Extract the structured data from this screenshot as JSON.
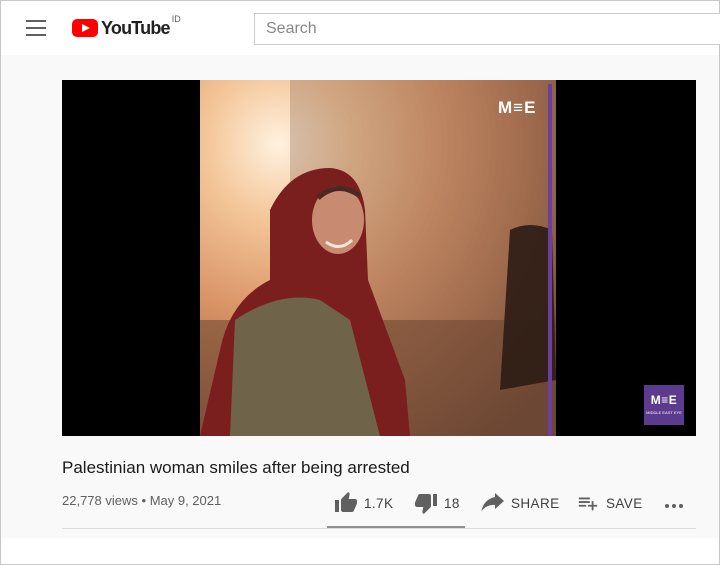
{
  "header": {
    "brand": "YouTube",
    "country_code": "ID",
    "search_placeholder": "Search"
  },
  "video": {
    "overlay_logo": "M≡E",
    "badge_text": "M≡E",
    "badge_subtext": "MIDDLE EAST EYE",
    "title": "Palestinian woman smiles after being arrested",
    "views": "22,778 views",
    "date": "May 9, 2021",
    "like_ratio": 0.99
  },
  "actions": {
    "likes": "1.7K",
    "dislikes": "18",
    "share_label": "SHARE",
    "save_label": "SAVE"
  },
  "colors": {
    "brand_red": "#ff0000",
    "mee_purple": "#5c3a8e",
    "icon_gray": "#606060"
  },
  "icons": [
    "menu-icon",
    "youtube-logo-icon",
    "thumb-up-icon",
    "thumb-down-icon",
    "share-icon",
    "playlist-add-icon",
    "more-icon"
  ]
}
